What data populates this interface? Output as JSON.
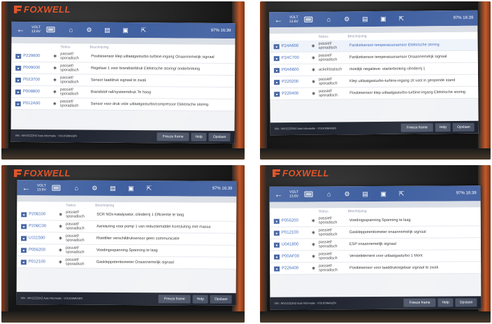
{
  "brand": "FOXWELL",
  "photos": [
    {
      "id": "tl",
      "show_brand": true,
      "voltage": "VOLT 13.6V",
      "status": "97%  16:39",
      "columns": {
        "code": "",
        "status": "Status",
        "desc": "Beschrijving"
      },
      "rows": [
        {
          "code": "P229800",
          "status": "passief/ sporadisch",
          "desc": "Positiesensor klep uitlaatgasturbo-turbine-ingang Onaannemelijk signaal",
          "sel": false
        },
        {
          "code": "P009000",
          "status": "passief/ sporadisch",
          "desc": "Regelaar 1 voor brandstofdruk Elektrische storing/ onderbreking",
          "sel": false
        },
        {
          "code": "P023700",
          "status": "passief/ sporadisch",
          "desc": "Sensor laaddruk signaal te zwak",
          "sel": false
        },
        {
          "code": "P008800",
          "status": "passief/ sporadisch",
          "desc": "Brandstof rail/systeemdruk Te hoog",
          "sel": false
        },
        {
          "code": "P012A00",
          "status": "passief/ sporadisch",
          "desc": "Sensor voor druk vóór uitlaatgasturbo/compressor Elektrische storing",
          "sel": false
        }
      ],
      "vin": "VIN : WV1ZZZ2HZ  Auto Informatie : VOLKSWAGEN",
      "buttons": [
        "Freeze frame",
        "Help",
        "Opslaan"
      ]
    },
    {
      "id": "tr",
      "show_brand": false,
      "voltage": "VOLT 13.6V",
      "status": "97%  16:39",
      "columns": {
        "code": "",
        "status": "Status",
        "desc": "Beschrijving"
      },
      "rows": [
        {
          "code": "P24A600",
          "status": "passief/ sporadisch",
          "desc": "Partikelsensor temperatuursensor Elektrische storing",
          "sel": true
        },
        {
          "code": "P24C700",
          "status": "passief/ sporadisch",
          "desc": "Partikelsensor temperatuursensor Onaannemelijk signaal",
          "sel": false
        },
        {
          "code": "P0A6800",
          "status": "actief/statisch",
          "desc": "moeilijk negatieve- starterbroking cilinderrij 1",
          "sel": false
        },
        {
          "code": "P220200",
          "status": "passief/ sporadisch",
          "desc": "Klep uitlaatgasturbo-turbine-ingang zit vast in geopende stand",
          "sel": false
        },
        {
          "code": "P220400",
          "status": "passief/ sporadisch",
          "desc": "Positiesensor klep uitlaatgasturbo-turbine-ingang Elektrische storing",
          "sel": false
        }
      ],
      "vin": "VIN : WV1ZZZ2HZ  Auto Informatie : VOLKSWAGEN",
      "buttons": [
        "Freeze frame",
        "Help",
        "Opslaan"
      ]
    },
    {
      "id": "bl",
      "show_brand": true,
      "voltage": "VOLT 13.6V",
      "status": "97%  16:39",
      "columns": {
        "code": "",
        "status": "Status",
        "desc": "Beschrijving"
      },
      "rows": [
        {
          "code": "P208100",
          "status": "passief/ sporadisch",
          "desc": "SCR NOx-katalysator, cilinderrij 1 Efficientie te laag",
          "sel": false
        },
        {
          "code": "P208C00",
          "status": "passief/ sporadisch",
          "desc": "Aansturing voor pomp 1 van reductiemiddel Kortsluiting met massa",
          "sel": false
        },
        {
          "code": "U111500",
          "status": "passief/ sporadisch",
          "desc": "Roetfilter verschildruksensor geen communicatie",
          "sel": false
        },
        {
          "code": "P056200",
          "status": "passief/ sporadisch",
          "desc": "Voedingsspanning Spanning te laag",
          "sel": false
        },
        {
          "code": "P012100",
          "status": "passief/ sporadisch",
          "desc": "Gaskleppotentiometer Onaannemelijk signaal",
          "sel": false
        }
      ],
      "vin": "VIN : WV1ZZZ2HZ  Auto Informatie : VOLKSWAGEN",
      "buttons": [
        "Freeze frame",
        "Help",
        "Opslaan"
      ]
    },
    {
      "id": "br",
      "show_brand": true,
      "voltage": "VOLT 13.6V",
      "status": "97%  16:39",
      "columns": {
        "code": "",
        "status": "Status",
        "desc": "Beschrijving"
      },
      "rows": [
        {
          "code": "P056200",
          "status": "passief/ sporadisch",
          "desc": "Voedingsspanning Spanning te laag",
          "sel": false
        },
        {
          "code": "P012100",
          "status": "passief/ sporadisch",
          "desc": "Gaskleppotentiometer onaannemelijk signaal",
          "sel": false
        },
        {
          "code": "U041800",
          "status": "passief/ sporadisch",
          "desc": "ESP onaannemelijk signaal",
          "sel": false
        },
        {
          "code": "P00AF00",
          "status": "passief/ sporadisch",
          "desc": "Verstelelement voor uitlaatgasturbo 1 Mont",
          "sel": false
        },
        {
          "code": "P226400",
          "status": "passief/ sporadisch",
          "desc": "Positiesensor voor laaddrukregelaar signaal te zwak",
          "sel": false
        }
      ],
      "vin": "VIN : WV1ZZZ2HZ  Auto Informatie : VOLKSWAGEN",
      "buttons": [
        "Freeze frame",
        "Help",
        "Opslaan"
      ]
    }
  ]
}
